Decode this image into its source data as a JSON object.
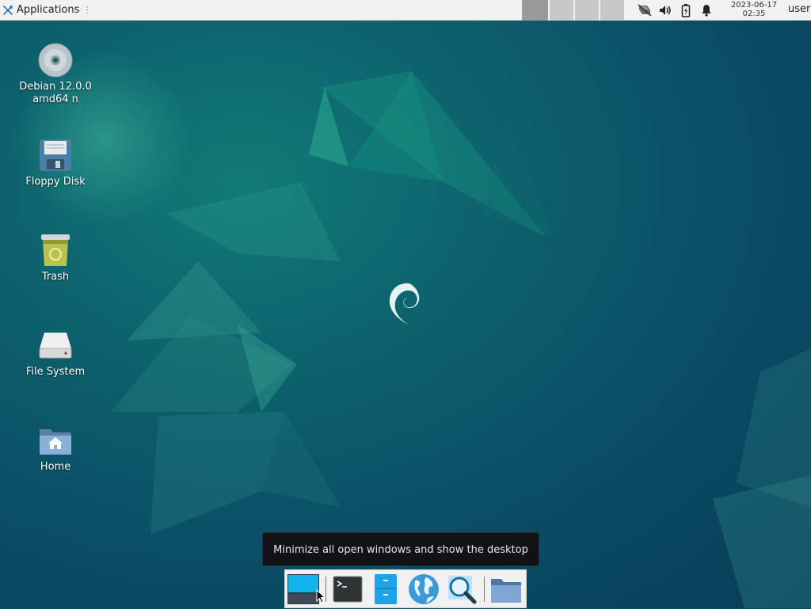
{
  "top_panel": {
    "applications_label": "Applications",
    "workspaces_count": 4,
    "active_workspace": 1,
    "clock_date": "2023-06-17",
    "clock_time": "02:35",
    "user": "user",
    "tray_icons": [
      "network-icon",
      "volume-icon",
      "battery-icon",
      "notification-bell-icon"
    ]
  },
  "desktop_icons": [
    {
      "label": "Debian 12.0.0 amd64 n",
      "icon": "cd-disc-icon"
    },
    {
      "label": "Floppy Disk",
      "icon": "floppy-disk-icon"
    },
    {
      "label": "Trash",
      "icon": "trash-icon"
    },
    {
      "label": "File System",
      "icon": "hard-drive-icon"
    },
    {
      "label": "Home",
      "icon": "home-folder-icon"
    }
  ],
  "tooltip": {
    "text": "Minimize all open windows and show the desktop"
  },
  "dock": {
    "items": [
      "show-desktop-icon",
      "terminal-icon",
      "file-manager-icon",
      "web-browser-icon",
      "app-finder-icon",
      "folder-icon"
    ]
  },
  "colors": {
    "panel_bg": "#f2f2f2",
    "desktop_base": "#0a4c64",
    "tooltip_bg": "#0f1316"
  }
}
